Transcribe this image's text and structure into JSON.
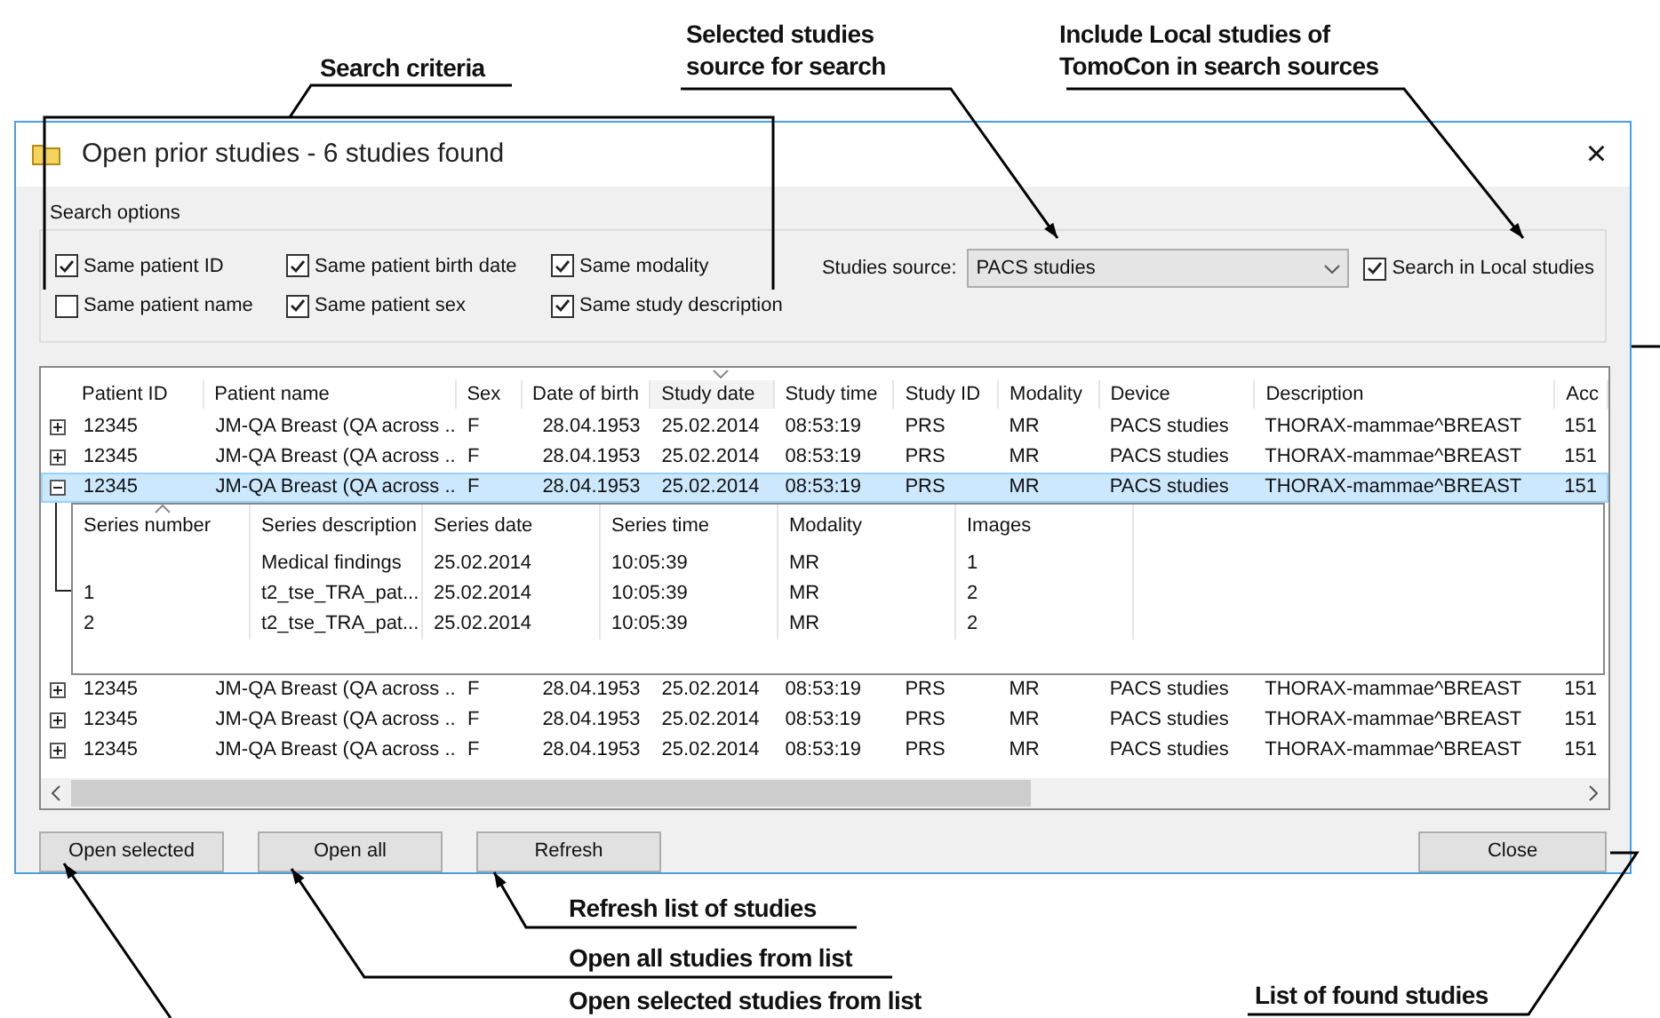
{
  "annotations": [
    {
      "text": "Search criteria"
    },
    {
      "text": "Selected studies source for search"
    },
    {
      "text": "Include Local studies of TomoCon in search sources"
    },
    {
      "text": "Refresh list of studies"
    },
    {
      "text": "Open all studies from list"
    },
    {
      "text": "Open selected studies from list"
    },
    {
      "text": "List of found studies"
    }
  ],
  "dialog": {
    "title": "Open prior studies - 6 studies found",
    "close": "×",
    "search_options": {
      "label": "Search options",
      "checkboxes": [
        {
          "label": "Same patient ID",
          "checked": true
        },
        {
          "label": "Same patient name",
          "checked": false
        },
        {
          "label": "Same patient birth date",
          "checked": true
        },
        {
          "label": "Same patient sex",
          "checked": true
        },
        {
          "label": "Same modality",
          "checked": true
        },
        {
          "label": "Same study description",
          "checked": true
        }
      ]
    },
    "studies_source": {
      "label": "Studies source:",
      "value": "PACS studies"
    },
    "search_local": {
      "label": "Search in Local studies",
      "checked": true
    },
    "grid": {
      "columns": [
        "Patient ID",
        "Patient name",
        "Sex",
        "Date of birth",
        "Study date",
        "Study time",
        "Study ID",
        "Modality",
        "Device",
        "Description",
        "Acc"
      ],
      "rows": [
        {
          "expanded": false,
          "selected": false,
          "cells": [
            "12345",
            "JM-QA Breast (QA across ...",
            "F",
            "28.04.1953",
            "25.02.2014",
            "08:53:19",
            "PRS",
            "MR",
            "PACS studies",
            "THORAX-mammae^BREAST",
            "151"
          ]
        },
        {
          "expanded": false,
          "selected": false,
          "cells": [
            "12345",
            "JM-QA Breast (QA across ...",
            "F",
            "28.04.1953",
            "25.02.2014",
            "08:53:19",
            "PRS",
            "MR",
            "PACS studies",
            "THORAX-mammae^BREAST",
            "151"
          ]
        },
        {
          "expanded": true,
          "selected": true,
          "cells": [
            "12345",
            "JM-QA Breast (QA across ...",
            "F",
            "28.04.1953",
            "25.02.2014",
            "08:53:19",
            "PRS",
            "MR",
            "PACS studies",
            "THORAX-mammae^BREAST",
            "151"
          ],
          "series": {
            "columns": [
              "Series number",
              "Series description",
              "Series date",
              "Series time",
              "Modality",
              "Images"
            ],
            "rows": [
              {
                "cells": [
                  null,
                  "Medical findings",
                  "25.02.2014",
                  "10:05:39",
                  "MR",
                  "1"
                ]
              },
              {
                "cells": [
                  "1",
                  "t2_tse_TRA_pat...",
                  "25.02.2014",
                  "10:05:39",
                  "MR",
                  "2"
                ]
              },
              {
                "cells": [
                  "2",
                  "t2_tse_TRA_pat...",
                  "25.02.2014",
                  "10:05:39",
                  "MR",
                  "2"
                ]
              }
            ]
          }
        },
        {
          "expanded": false,
          "selected": false,
          "cells": [
            "12345",
            "JM-QA Breast (QA across ...",
            "F",
            "28.04.1953",
            "25.02.2014",
            "08:53:19",
            "PRS",
            "MR",
            "PACS studies",
            "THORAX-mammae^BREAST",
            "151"
          ]
        },
        {
          "expanded": false,
          "selected": false,
          "cells": [
            "12345",
            "JM-QA Breast (QA across ...",
            "F",
            "28.04.1953",
            "25.02.2014",
            "08:53:19",
            "PRS",
            "MR",
            "PACS studies",
            "THORAX-mammae^BREAST",
            "151"
          ]
        },
        {
          "expanded": false,
          "selected": false,
          "cells": [
            "12345",
            "JM-QA Breast (QA across ...",
            "F",
            "28.04.1953",
            "25.02.2014",
            "08:53:19",
            "PRS",
            "MR",
            "PACS studies",
            "THORAX-mammae^BREAST",
            "151"
          ]
        }
      ]
    },
    "buttons": [
      "Open selected",
      "Open all",
      "Refresh"
    ],
    "close_button": "Close"
  }
}
